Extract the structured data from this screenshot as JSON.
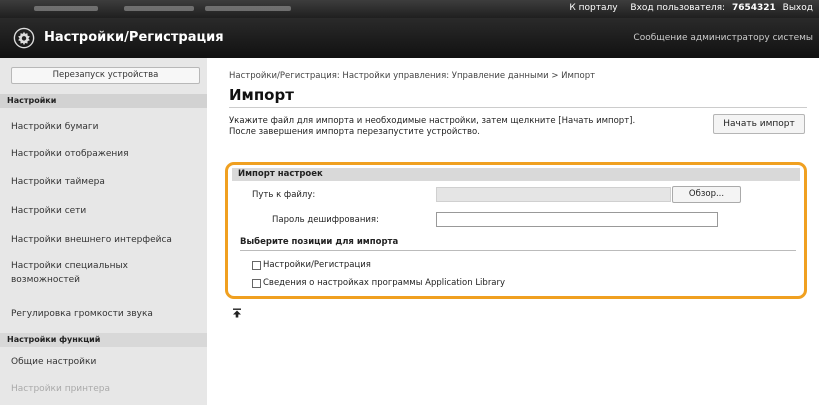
{
  "header": {
    "portal_link": "К порталу",
    "login_label": "Вход пользователя:",
    "user_id": "7654321",
    "logout_link": "Выход",
    "app_title": "Настройки/Регистрация",
    "admin_message": "Сообщение администратору системы"
  },
  "sidebar": {
    "restart_button": "Перезапуск устройства",
    "section_settings": "Настройки",
    "items": [
      "Настройки бумаги",
      "Настройки отображения",
      "Настройки таймера",
      "Настройки сети",
      "Настройки внешнего интерфейса",
      "Настройки специальных возможностей",
      "Регулировка громкости звука"
    ],
    "section_functions": "Настройки функций",
    "function_items": [
      "Общие настройки",
      "Настройки принтера"
    ]
  },
  "main": {
    "breadcrumb": "Настройки/Регистрация: Настройки управления: Управление данными > Импорт",
    "page_title": "Импорт",
    "instruction_line1": "Укажите файл для импорта и необходимые настройки, затем щелкните [Начать импорт].",
    "instruction_line2": "После завершения импорта перезапустите устройство.",
    "start_import_button": "Начать импорт",
    "panel_title": "Импорт настроек",
    "file_path_label": "Путь к файлу:",
    "browse_button": "Обзор...",
    "password_label": "Пароль дешифрования:",
    "password_value": "",
    "select_items_title": "Выберите позиции для импорта",
    "checkboxes": [
      {
        "label": "Настройки/Регистрация",
        "checked": false
      },
      {
        "label": "Сведения о настройках программы Application Library",
        "checked": false
      }
    ]
  },
  "colors": {
    "highlight": "#f0a020",
    "topbar": "#2a2a2a",
    "sidebar_bg": "#e7e7e7"
  },
  "icons": {
    "logo": "gear-icon",
    "top_link": "arrow-to-top-icon"
  }
}
